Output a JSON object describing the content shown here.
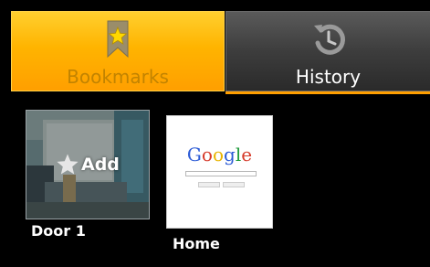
{
  "tabs": [
    {
      "label": "Bookmarks",
      "icon": "bookmark-star-icon",
      "selected": true,
      "color": "#ffb400"
    },
    {
      "label": "History",
      "icon": "history-icon",
      "selected": false,
      "color": "#3d3d3d"
    }
  ],
  "bookmarks": [
    {
      "title": "Door 1",
      "overlay_label": "Add",
      "overlay_icon": "star-icon"
    },
    {
      "title": "Home",
      "thumbnail_logo": "Google"
    }
  ],
  "colors": {
    "accent": "#ff9f00",
    "background": "#000000"
  }
}
